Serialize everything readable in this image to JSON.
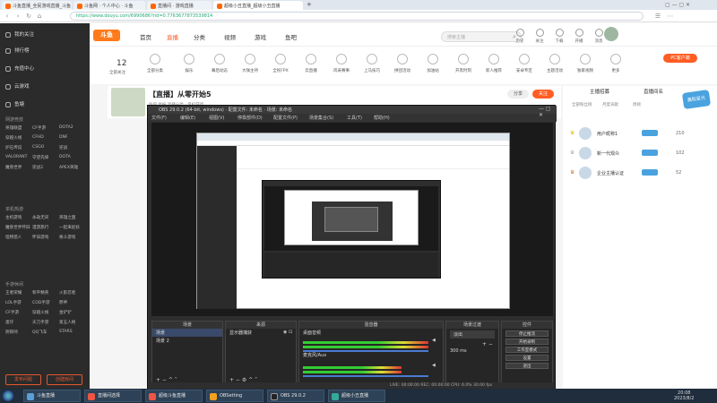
{
  "browser": {
    "tabs": [
      {
        "label": "斗鱼直播_全民游戏直播_斗鱼"
      },
      {
        "label": "斗鱼网 · 个人中心 · 斗鱼"
      },
      {
        "label": "直播间 · 游戏直播"
      },
      {
        "label": "超级小丑直播_超级小丑直播"
      }
    ],
    "url": "https://www.douyu.com/6990686?rid=0.7763677873539814"
  },
  "sidebar": {
    "items": [
      {
        "label": "我的关注"
      },
      {
        "label": "排行榜"
      },
      {
        "label": "充值中心"
      },
      {
        "label": "云游戏"
      },
      {
        "label": "鱼塘"
      }
    ],
    "sections": [
      {
        "title": "网游竞技",
        "items": [
          "英雄联盟",
          "CF手游",
          "DOTA2",
          "穿越火线",
          "CFHD",
          "DNF",
          "炉石传说",
          "CSGO",
          "逆战",
          "VALORANT",
          "守望先锋",
          "DOTA",
          "魔兽世界",
          "逆战2",
          "APEX英雄"
        ]
      },
      {
        "title": "单机热游",
        "items": [
          "主机游戏",
          "永劫无间",
          "英雄之国",
          "魔兽世界怀旧",
          "漫游旅行",
          "一起来捉妖",
          "怪物猎人",
          "怀旧游戏",
          "格斗游戏"
        ]
      },
      {
        "title": "手游休闲",
        "items": [
          "王者荣耀",
          "和平精英",
          "火影忍者",
          "LOL手游",
          "COD手游",
          "原神",
          "CF手游",
          "穿越火线",
          "金铲铲",
          "蛋仔",
          "天刀手游",
          "第五人格",
          "阴阳师",
          "QQ飞车",
          "STARS"
        ]
      }
    ],
    "buttons": {
      "left": "发布问题",
      "right": "创建房间"
    }
  },
  "topnav": {
    "logo": "斗鱼",
    "items": [
      "首页",
      "直播",
      "分类",
      "视频",
      "游戏",
      "鱼吧"
    ],
    "active_index": 1,
    "search_placeholder": "搜索主播",
    "icons": [
      {
        "name": "history-icon",
        "label": "历史"
      },
      {
        "name": "follow-icon",
        "label": "关注"
      },
      {
        "name": "download-icon",
        "label": "下载"
      },
      {
        "name": "open-live-icon",
        "label": "开播"
      },
      {
        "name": "message-icon",
        "label": "消息"
      }
    ]
  },
  "catbar": {
    "follow_count": "12",
    "follow_label": "全部关注",
    "categories": [
      "全部分类",
      "娱乐",
      "幕后动态",
      "大咖主持",
      "全民FPX",
      "云直播",
      "风采赛事",
      "上马技巧",
      "拼团活动",
      "加油站",
      "开黑时刻",
      "新人推荐",
      "安卓专区",
      "主题活动",
      "独家视频",
      "更多"
    ],
    "badge": "PC客户端"
  },
  "stream": {
    "title": "【直播】从零开始5",
    "meta": "鱼吧  举报  直播分类 · 单机游戏",
    "follow_label": "关注",
    "share_label": "分享"
  },
  "rightpanel": {
    "tabs": [
      "主播招募",
      "直播间名"
    ],
    "subtabs": [
      "全部粉丝榜",
      "月度贡献",
      "周榜"
    ],
    "rows": [
      {
        "name": "用户昵称1",
        "score": "210"
      },
      {
        "name": "新一代观众",
        "score": "102"
      },
      {
        "name": "企业主播认证",
        "score": "52"
      }
    ],
    "promo": "赢取星光"
  },
  "obs": {
    "title": "OBS 29.0.2 (64-bit, windows) · 配置文件: 未命名 · 场景: 未命名",
    "menu": [
      "文件(F)",
      "编辑(E)",
      "视图(V)",
      "停靠部件(D)",
      "配置文件(P)",
      "场景集合(S)",
      "工具(T)",
      "帮助(H)"
    ],
    "panels": {
      "scenes": {
        "title": "场景",
        "items": [
          "场景",
          "场景 2"
        ]
      },
      "sources": {
        "title": "来源",
        "items": [
          "显示器捕获"
        ]
      },
      "mixer": {
        "title": "混音器",
        "tracks": [
          "桌面音频",
          "麦克风/Aux"
        ]
      },
      "transitions": {
        "title": "场景过渡",
        "value": "淡出",
        "duration": "300 ms"
      },
      "controls": {
        "title": "控件",
        "buttons": [
          "停止推流",
          "开始录制",
          "工作室模式",
          "设置",
          "退出"
        ]
      }
    },
    "status": "LIVE: 00:00:00   REC: 00:00:00   CPU: 6.0%   30.00 fps"
  },
  "taskbar": {
    "items": [
      "斗鱼直播",
      "直播间选择",
      "超级斗鱼直播",
      "OBSetting",
      "OBS 29.0.2",
      "超级小丑直播"
    ],
    "clock_time": "20:08",
    "clock_date": "2023/8/2"
  }
}
